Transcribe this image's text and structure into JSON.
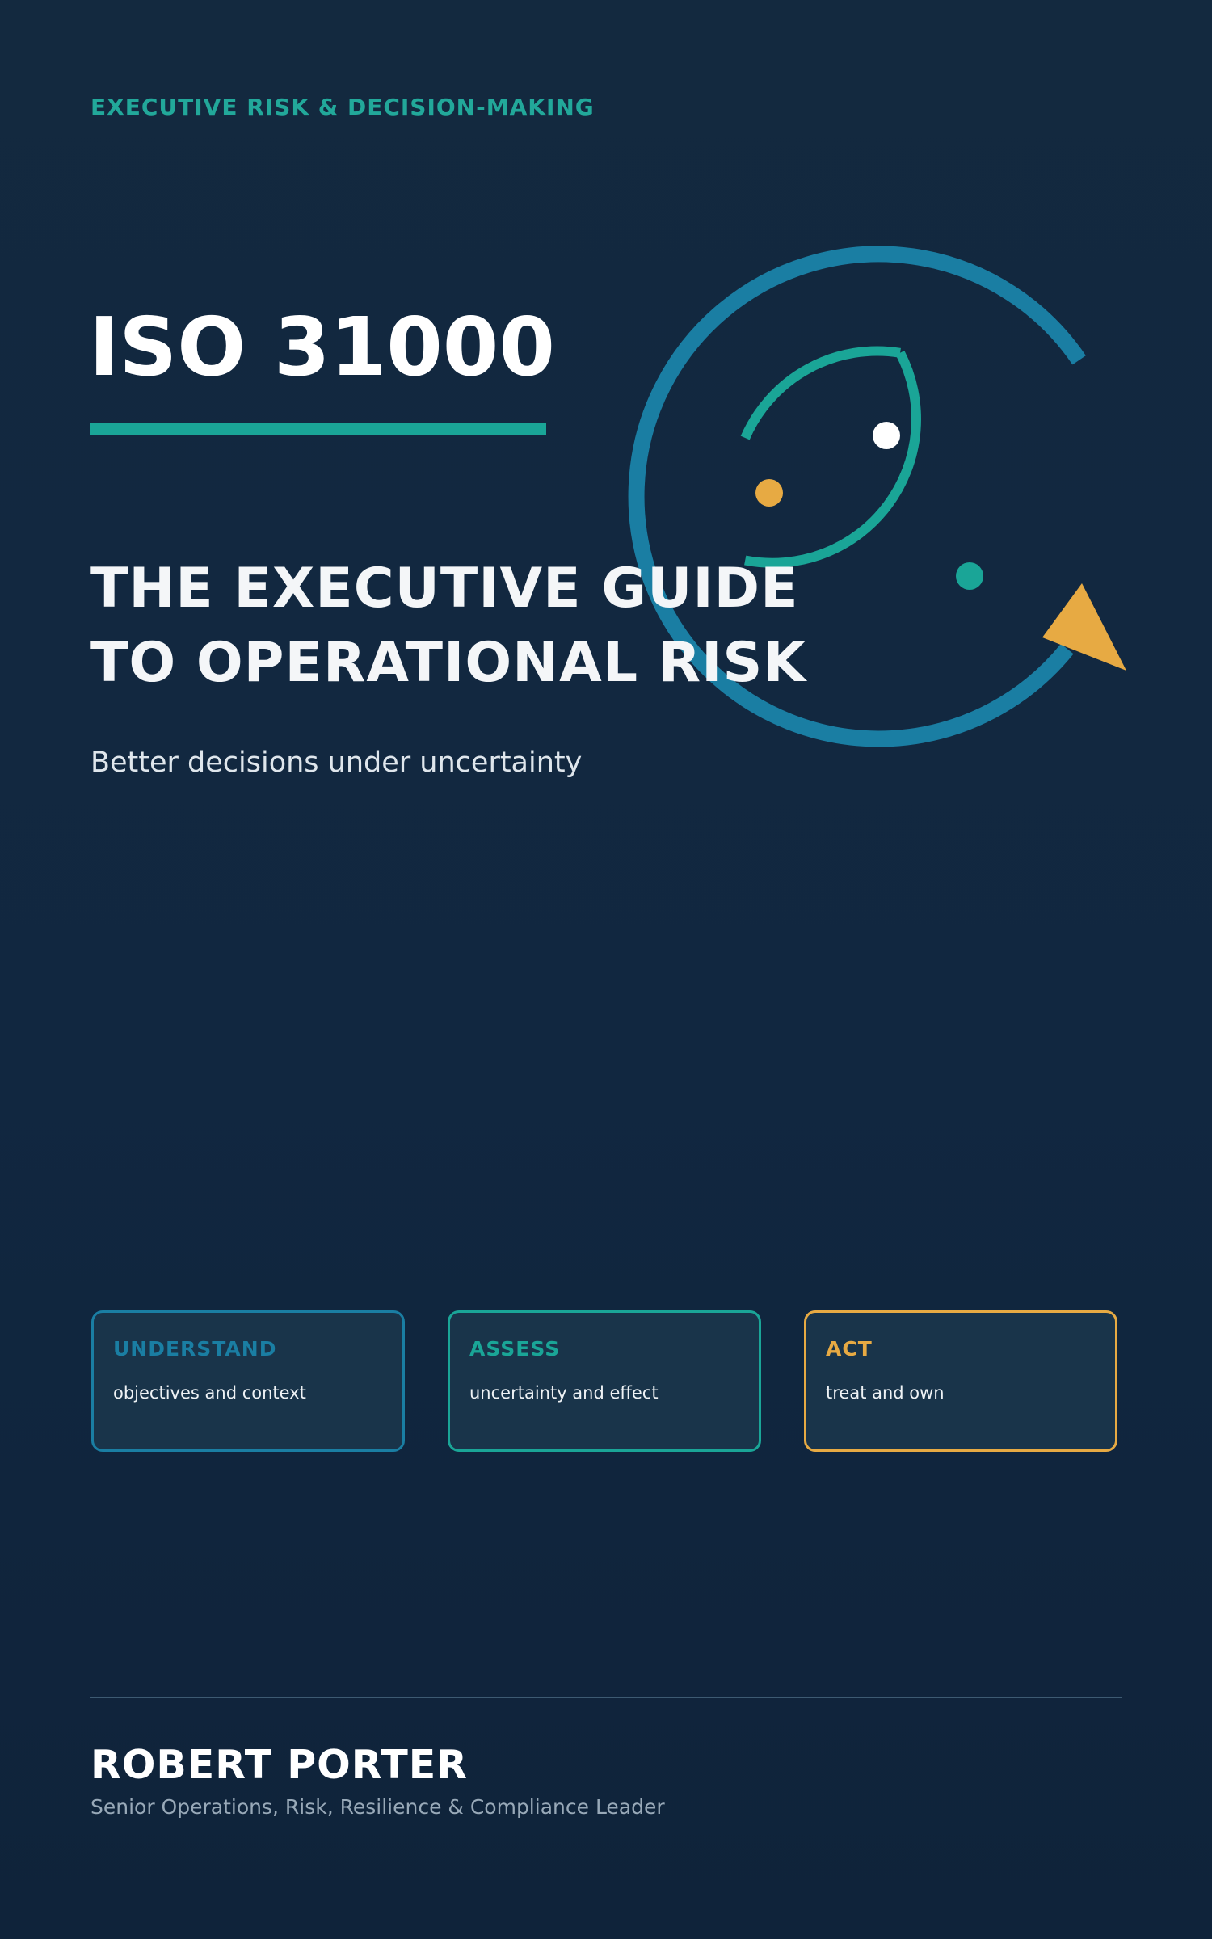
{
  "cover": {
    "eyebrow": "EXECUTIVE RISK & DECISION-MAKING",
    "title": "ISO 31000",
    "subtitle_lines": [
      "THE EXECUTIVE GUIDE",
      "TO OPERATIONAL RISK"
    ],
    "tagline": "Better decisions under uncertainty"
  },
  "pillars": [
    {
      "title": "UNDERSTAND",
      "description": "objectives and context"
    },
    {
      "title": "ASSESS",
      "description": "uncertainty and effect"
    },
    {
      "title": "ACT",
      "description": "treat and own"
    }
  ],
  "author": {
    "name": "ROBERT PORTER",
    "role": "Senior Operations, Risk, Resilience & Compliance Leader"
  },
  "colors": {
    "background": "#12283f",
    "teal": "#1aa597",
    "blue": "#1a7ea3",
    "amber": "#e7aa43",
    "white": "#ffffff"
  },
  "icons": {
    "emblem": "risk-cycle-emblem-icon"
  }
}
